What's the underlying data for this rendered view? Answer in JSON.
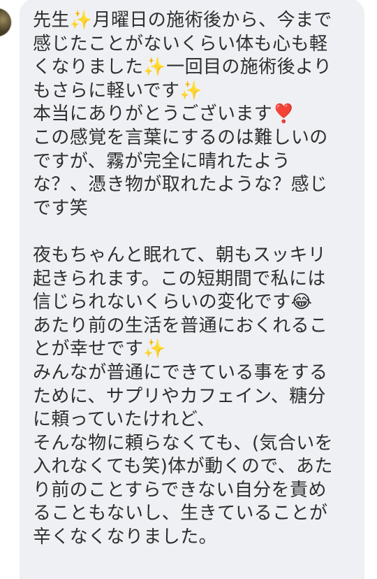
{
  "avatar": {
    "icon": "avatar"
  },
  "colors": {
    "bubble_background": "#eff0f3",
    "text": "#2f2f2f",
    "page_background": "#ffffff"
  },
  "message": {
    "lines": [
      "先生✨月曜日の施術後から、今まで",
      "感じたことがないくらい体も心も軽",
      "くなりました✨一回目の施術後より",
      "もさらに軽いです✨",
      "本当にありがとうございます❣️",
      "この感覚を言葉にするのは難しいの",
      "ですが、霧が完全に晴れたよう",
      "な？、憑き物が取れたような？感じ",
      "です笑",
      "",
      "夜もちゃんと眠れて、朝もスッキリ",
      "起きられます。この短期間で私には",
      "信じられないくらいの変化です😂",
      "あたり前の生活を普通におくれるこ",
      "とが幸せです✨",
      "みんなが普通にできている事をする",
      "ために、サプリやカフェイン、糖分",
      "に頼っていたけれど、",
      "そんな物に頼らなくても、(気合いを",
      "入れなくても笑)体が動くので、あた",
      "り前のことすらできない自分を責め",
      "ることもないし、生きていることが",
      "辛くなくなりました。"
    ]
  }
}
